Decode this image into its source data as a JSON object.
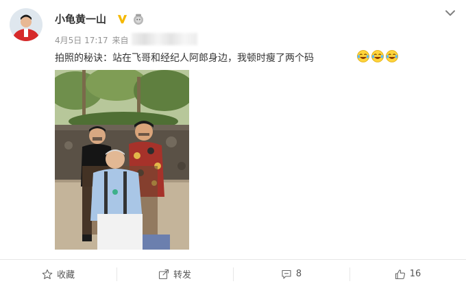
{
  "post": {
    "username": "小龟黄一山",
    "date": "4月5日",
    "time": "17:17",
    "source_prefix": "来自",
    "text": "拍照的秘诀：站在飞哥和经纪人阿郎身边，我顿时瘦了两个码",
    "emojis": [
      "laughing-tears-emoji",
      "laughing-tears-emoji",
      "laughing-tears-emoji"
    ]
  },
  "actions": {
    "favorite_label": "收藏",
    "repost_label": "转发",
    "comment_count": "8",
    "like_count": "16"
  },
  "icons": {
    "verified": "verified-badge-icon",
    "vip": "vip-badge-icon",
    "menu": "chevron-down-icon",
    "favorite": "star-icon",
    "repost": "share-icon",
    "comment": "comment-icon",
    "like": "thumbs-up-icon"
  },
  "colors": {
    "verified_gold": "#f5b800",
    "text": "#333333",
    "meta": "#939393",
    "divider": "#e6e6e6"
  }
}
